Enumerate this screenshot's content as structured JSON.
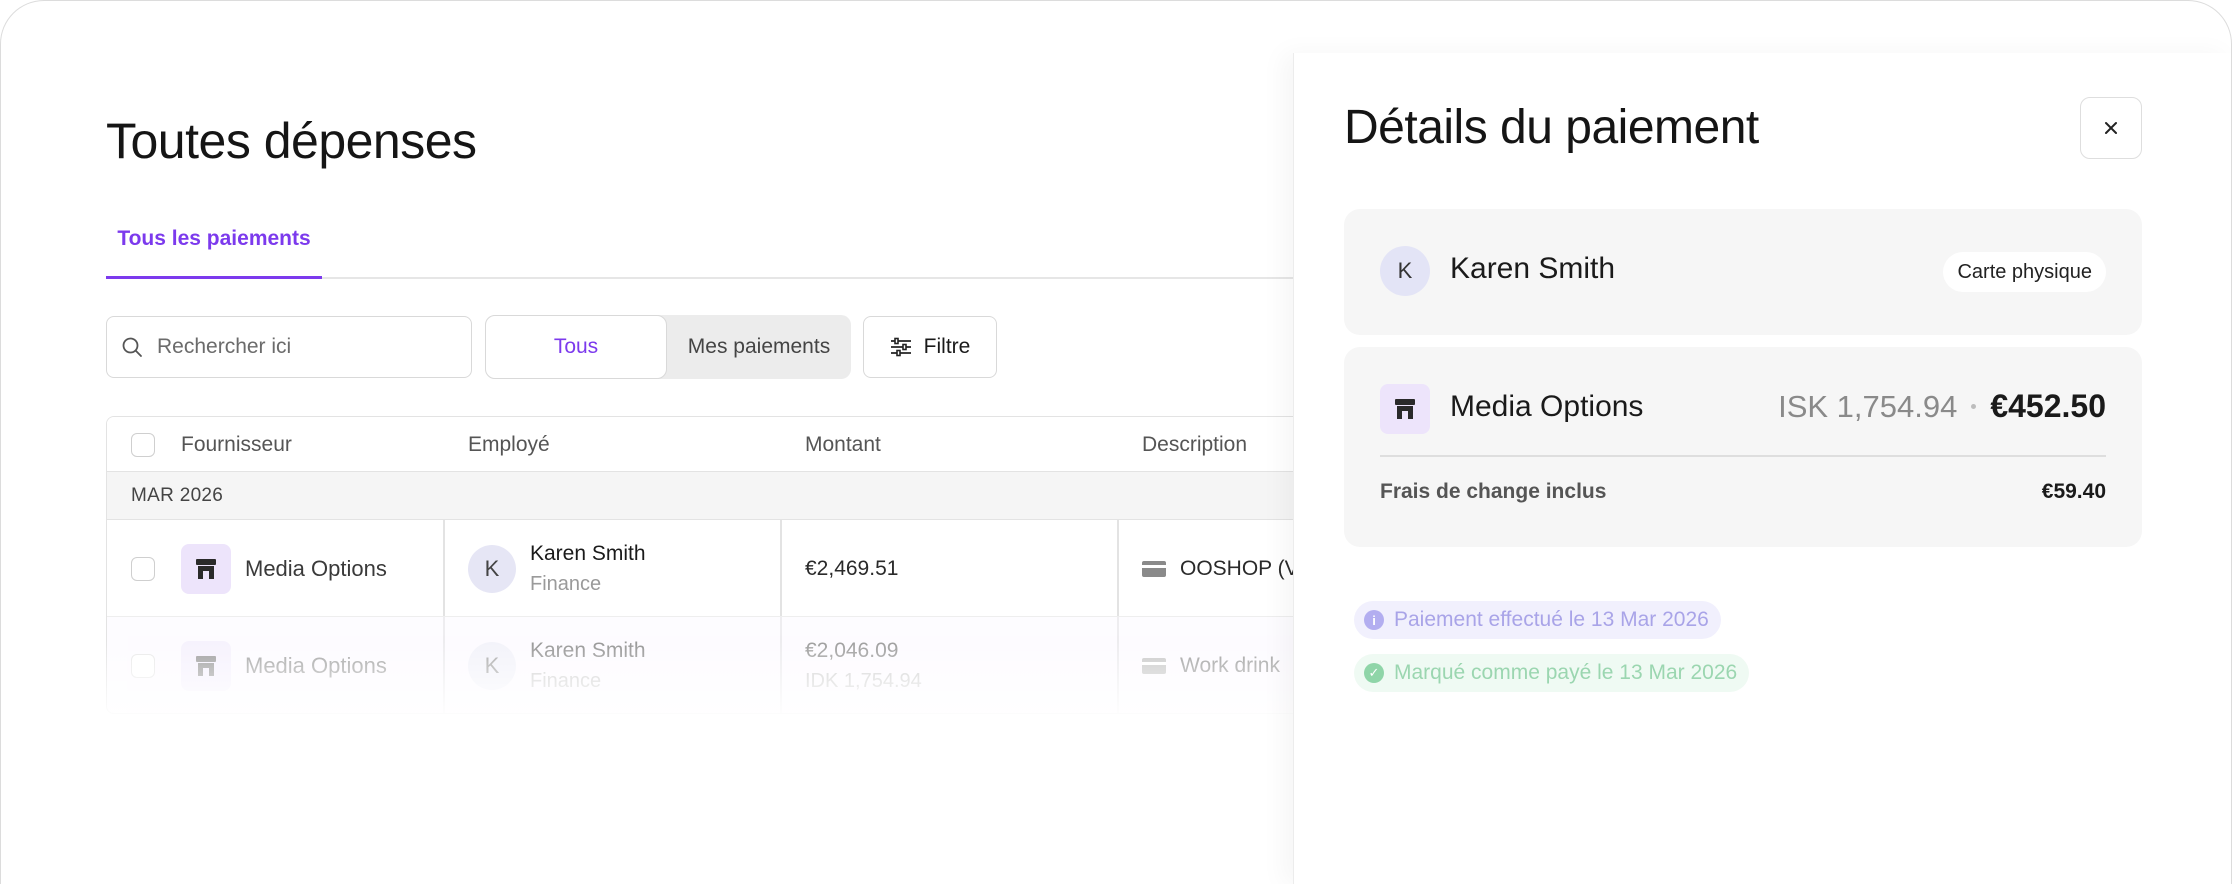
{
  "page": {
    "title": "Toutes dépenses",
    "tabs": [
      {
        "label": "Tous les paiements",
        "active": true
      }
    ]
  },
  "toolbar": {
    "search_placeholder": "Rechercher ici",
    "segment": {
      "all_label": "Tous",
      "mine_label": "Mes paiements",
      "selected": "Tous"
    },
    "filter_label": "Filtre"
  },
  "table": {
    "columns": [
      "Fournisseur",
      "Employé",
      "Montant",
      "Description"
    ],
    "group_label": "MAR 2026",
    "rows": [
      {
        "vendor": "Media Options",
        "employee_initial": "K",
        "employee_name": "Karen Smith",
        "employee_dept": "Finance",
        "amount": "€2,469.51",
        "amount_sub": "",
        "description": "OOSHOP (V"
      },
      {
        "vendor": "Media Options",
        "employee_initial": "K",
        "employee_name": "Karen Smith",
        "employee_dept": "Finance",
        "amount": "€2,046.09",
        "amount_sub": "IDK 1,754.94",
        "description": "Work drink"
      }
    ]
  },
  "drawer": {
    "title": "Détails du paiement",
    "close_icon": "close-icon",
    "employee": {
      "initial": "K",
      "name": "Karen Smith",
      "card_type": "Carte physique"
    },
    "merchant": {
      "name": "Media Options",
      "foreign_amount": "ISK 1,754.94",
      "amount": "€452.50",
      "fx_label": "Frais de change inclus",
      "fx_value": "€59.40"
    },
    "statuses": [
      {
        "text": "Paiement effectué le 13 Mar 2026",
        "icon": "info-icon"
      },
      {
        "text": "Marqué comme payé le 13 Mar 2026",
        "icon": "check-icon"
      }
    ]
  },
  "colors": {
    "accent": "#7c3aed",
    "vendor_logo_bg": "#ede4fb",
    "status_info": "#b3aef0",
    "status_success": "#8fd5a8"
  }
}
